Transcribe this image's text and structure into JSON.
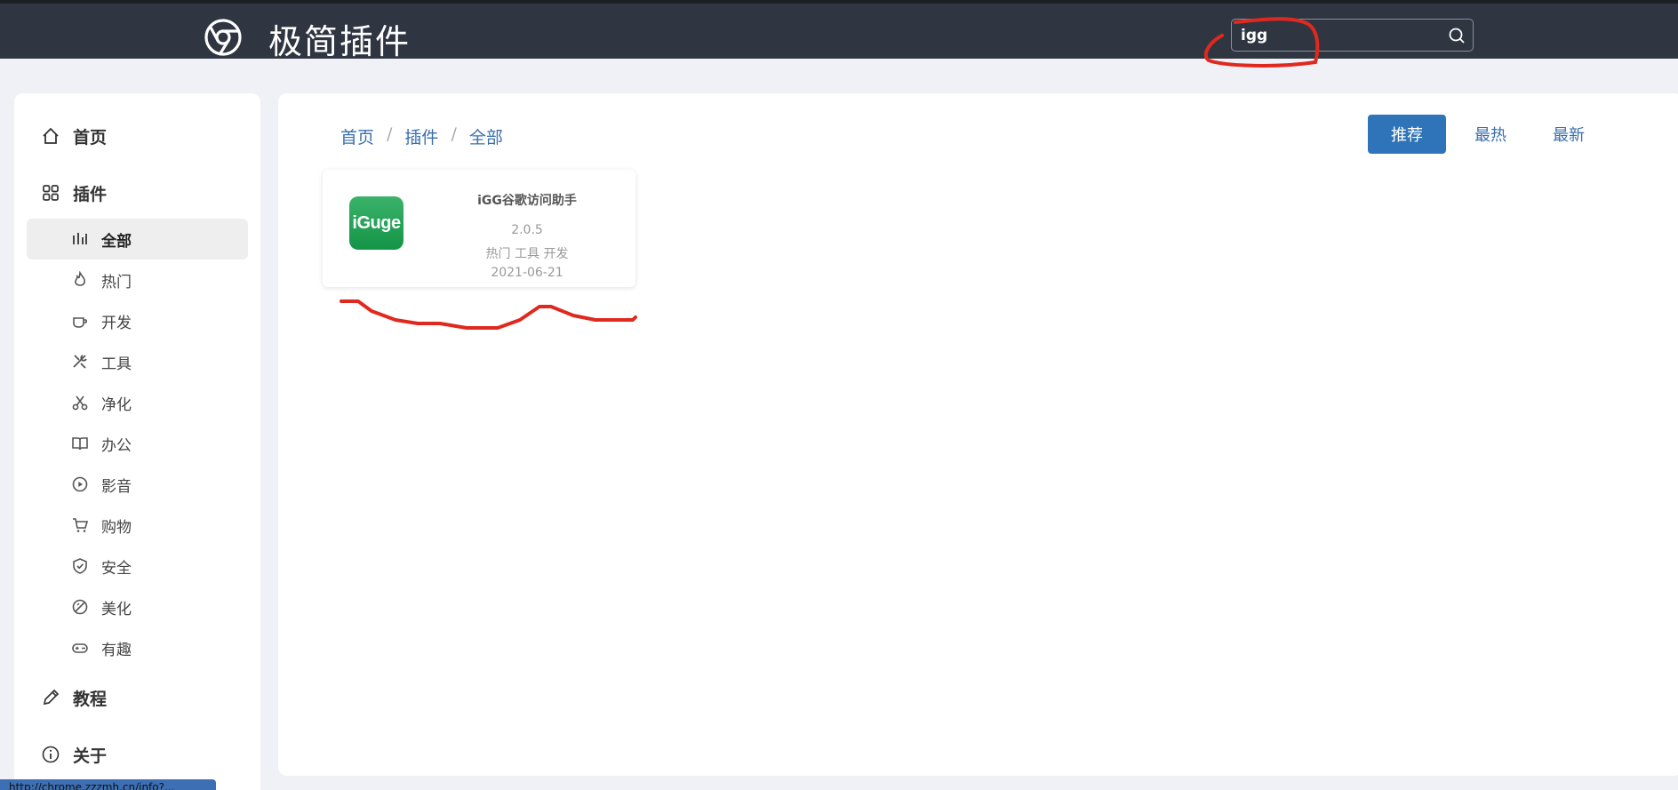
{
  "header": {
    "site_title": "极简插件",
    "search_value": "igg"
  },
  "sidebar": {
    "home": "首页",
    "plugins": "插件",
    "sub_items": [
      "全部",
      "热门",
      "开发",
      "工具",
      "净化",
      "办公",
      "影音",
      "购物",
      "安全",
      "美化",
      "有趣"
    ],
    "tutorial": "教程",
    "about": "关于"
  },
  "main": {
    "breadcrumb": [
      "首页",
      "插件",
      "全部"
    ],
    "sort": [
      "推荐",
      "最热",
      "最新"
    ]
  },
  "card": {
    "icon_text": "iGuge",
    "title": "iGG谷歌访问助手",
    "version": "2.0.5",
    "tags": "热门 工具 开发",
    "date": "2021-06-21"
  },
  "status_bar": "http://chrome.zzzmh.cn/info?..."
}
